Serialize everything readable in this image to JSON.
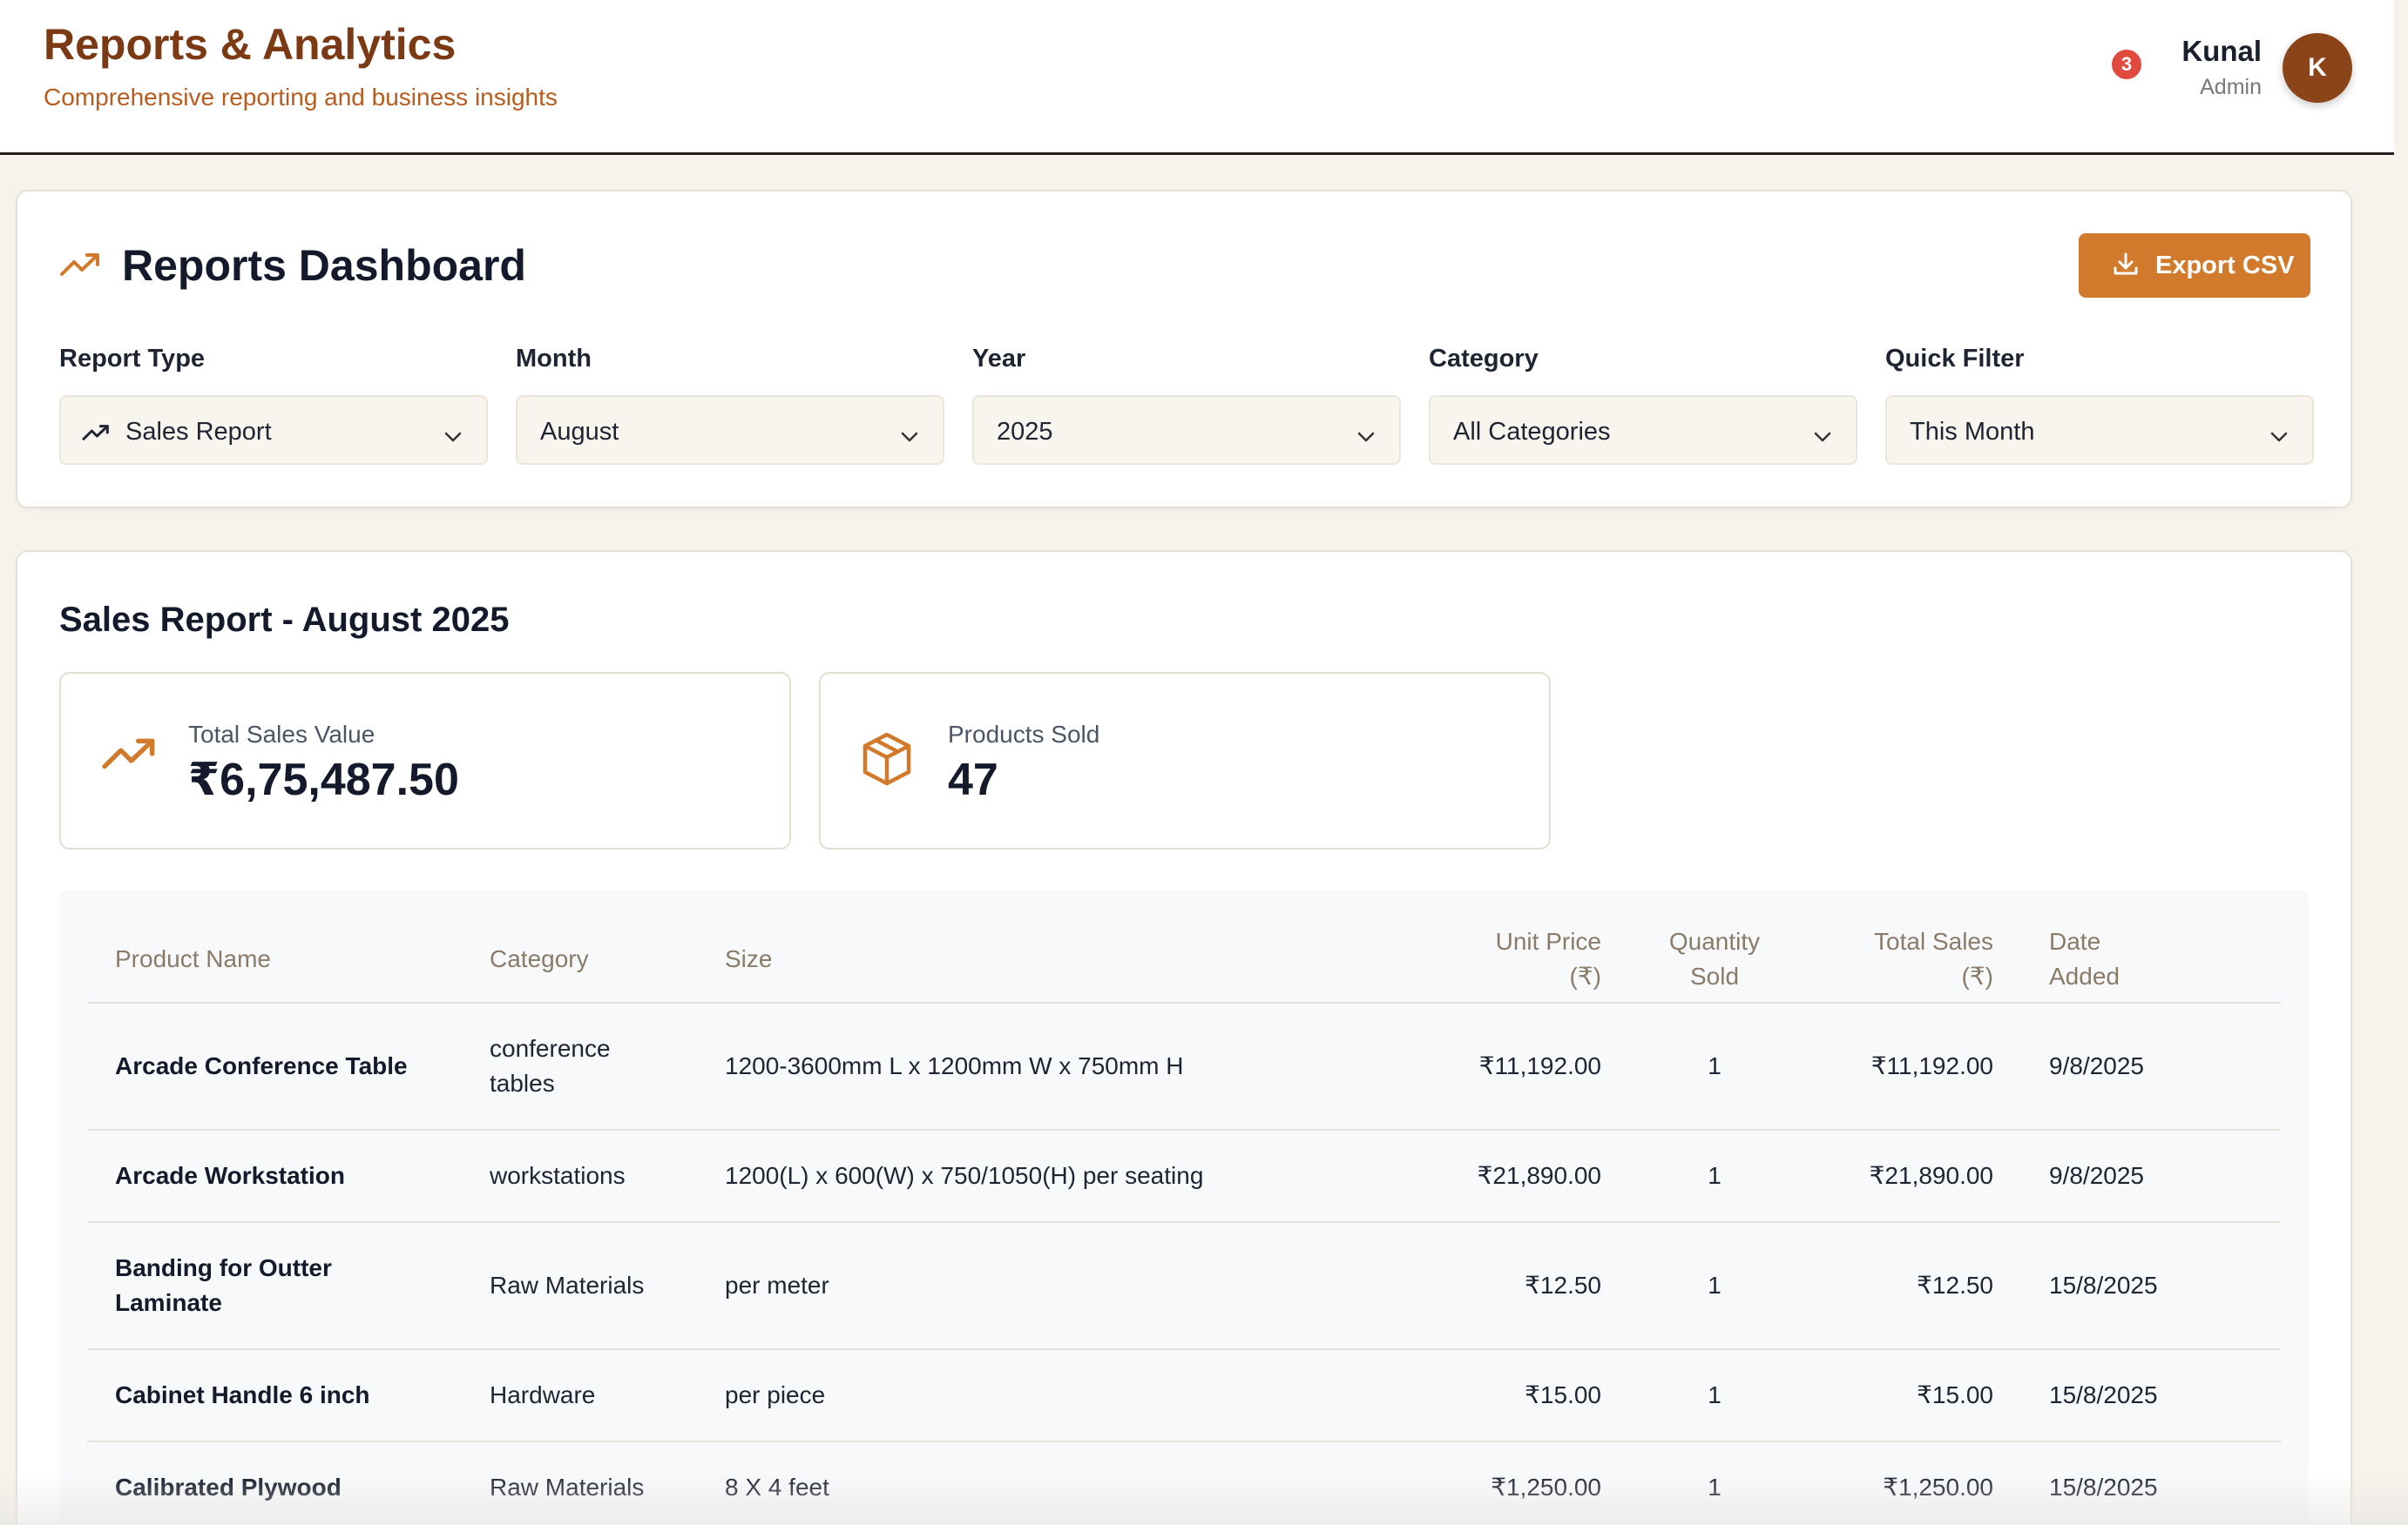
{
  "header": {
    "title": "Reports & Analytics",
    "subtitle": "Comprehensive reporting and business insights",
    "notification_count": "3",
    "user_name": "Kunal",
    "user_role": "Admin",
    "avatar_initial": "K"
  },
  "dashboard": {
    "title": "Reports Dashboard",
    "export_label": "Export CSV",
    "filters": [
      {
        "label": "Report Type",
        "value": "Sales Report"
      },
      {
        "label": "Month",
        "value": "August"
      },
      {
        "label": "Year",
        "value": "2025"
      },
      {
        "label": "Category",
        "value": "All Categories"
      },
      {
        "label": "Quick Filter",
        "value": "This Month"
      }
    ]
  },
  "report": {
    "title": "Sales Report - August 2025",
    "stats": [
      {
        "label": "Total Sales Value",
        "value": "₹6,75,487.50",
        "icon": "trending-up-icon"
      },
      {
        "label": "Products Sold",
        "value": "47",
        "icon": "package-icon"
      }
    ],
    "columns": {
      "product": "Product Name",
      "category": "Category",
      "size": "Size",
      "unit_price_1": "Unit Price",
      "unit_price_2": "(₹)",
      "qty_1": "Quantity",
      "qty_2": "Sold",
      "total_1": "Total Sales",
      "total_2": "(₹)",
      "date_1": "Date",
      "date_2": "Added"
    },
    "rows": [
      {
        "product": "Arcade Conference Table",
        "category_1": "conference",
        "category_2": "tables",
        "size": "1200-3600mm L x 1200mm W x 750mm H",
        "unit_price": "₹11,192.00",
        "qty": "1",
        "total": "₹11,192.00",
        "date": "9/8/2025"
      },
      {
        "product": "Arcade Workstation",
        "category_1": "workstations",
        "category_2": "",
        "size": "1200(L) x 600(W) x 750/1050(H) per seating",
        "unit_price": "₹21,890.00",
        "qty": "1",
        "total": "₹21,890.00",
        "date": "9/8/2025"
      },
      {
        "product_1": "Banding for Outter",
        "product_2": "Laminate",
        "category_1": "Raw Materials",
        "category_2": "",
        "size": "per meter",
        "unit_price": "₹12.50",
        "qty": "1",
        "total": "₹12.50",
        "date": "15/8/2025"
      },
      {
        "product": "Cabinet Handle 6 inch",
        "category_1": "Hardware",
        "category_2": "",
        "size": "per piece",
        "unit_price": "₹15.00",
        "qty": "1",
        "total": "₹15.00",
        "date": "15/8/2025"
      },
      {
        "product": "Calibrated Plywood",
        "category_1": "Raw Materials",
        "category_2": "",
        "size": "8 X 4 feet",
        "unit_price": "₹1,250.00",
        "qty": "1",
        "total": "₹1,250.00",
        "date": "15/8/2025"
      }
    ]
  },
  "colors": {
    "brand_dark": "#7b3a14",
    "accent": "#d27a2c",
    "notification": "#e04a3f"
  }
}
